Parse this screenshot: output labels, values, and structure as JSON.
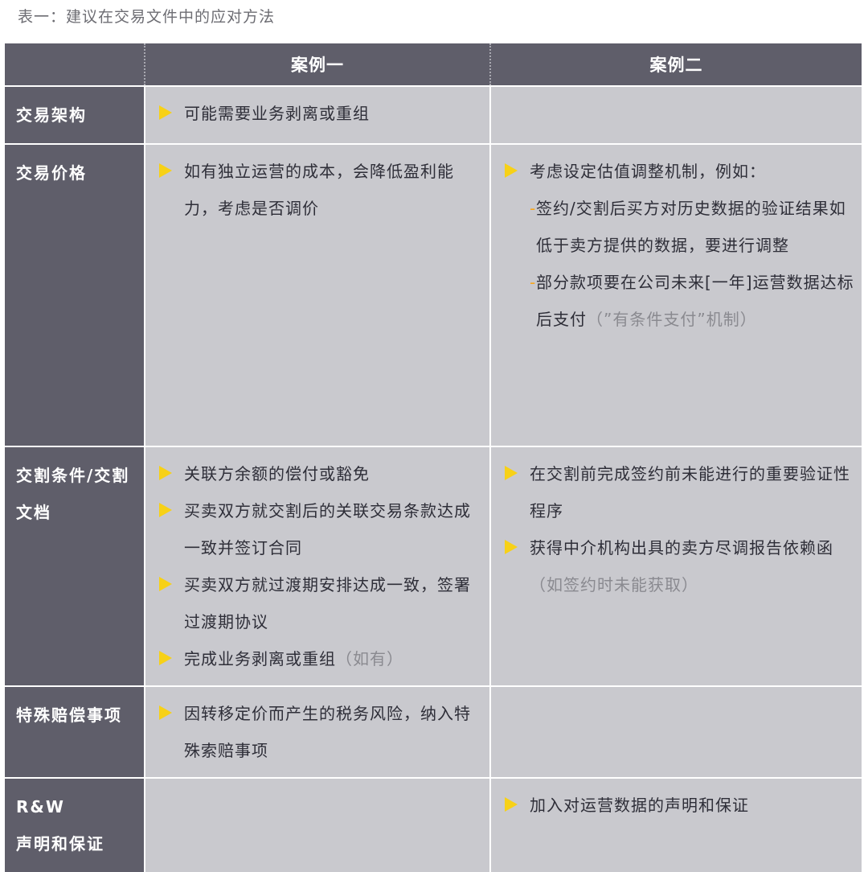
{
  "caption": "表一：建议在交易文件中的应对方法",
  "header": {
    "col1": "案例一",
    "col2": "案例二"
  },
  "rows": {
    "structure": {
      "label": "交易架构",
      "case1": [
        "可能需要业务剥离或重组"
      ]
    },
    "price": {
      "label": "交易价格",
      "case1": [
        "如有独立运营的成本，会降低盈利能力，考虑是否调价"
      ],
      "case2_lead": "考虑设定估值调整机制，例如：",
      "case2_sub1": "签约/交割后买方对历史数据的验证结果如低于卖方提供的数据，要进行调整",
      "case2_sub2_main": "部分款项要在公司未来[一年]运营数据达标后支付",
      "case2_sub2_note": "（”有条件支付”机制）"
    },
    "closing": {
      "label": "交割条件/交割文档",
      "case1": [
        "关联方余额的偿付或豁免",
        "买卖双方就交割后的关联交易条款达成一致并签订合同",
        "买卖双方就过渡期安排达成一致，签署过渡期协议"
      ],
      "case1_last_main": "完成业务剥离或重组",
      "case1_last_note": "（如有）",
      "case2": [
        "在交割前完成签约前未能进行的重要验证性程序"
      ],
      "case2_last_main": "获得中介机构出具的卖方尽调报告依赖函",
      "case2_last_note": "（如签约时未能获取）"
    },
    "indemnity": {
      "label": "特殊赔偿事项",
      "case1": [
        "因转移定价而产生的税务风险，纳入特殊索赔事项"
      ]
    },
    "rw": {
      "label_line1": "R&W",
      "label_line2": "声明和保证",
      "case2": [
        "加入对运营数据的声明和保证"
      ]
    }
  },
  "colors": {
    "header_bg": "#5f5e6a",
    "cell_bg": "#c9c9ce",
    "bullet": "#f7d117",
    "dash": "#f7a71c"
  }
}
